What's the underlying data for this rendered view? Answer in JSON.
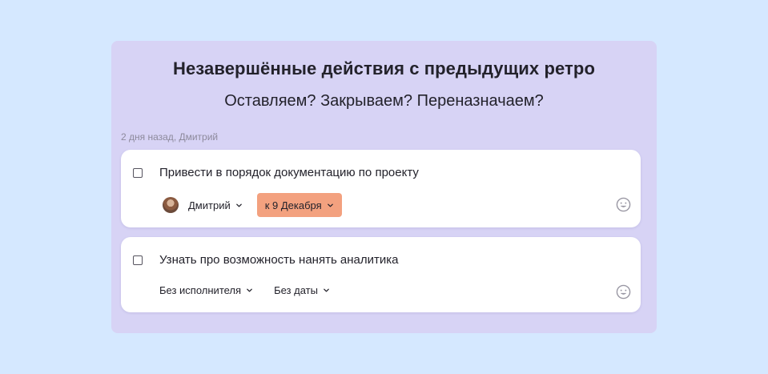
{
  "panel": {
    "title": "Незавершённые действия с предыдущих ретро",
    "subtitle": "Оставляем? Закрываем? Переназначаем?",
    "meta": "2 дня назад, Дмитрий"
  },
  "tasks": [
    {
      "text": "Привести в порядок документацию по проекту",
      "assignee": "Дмитрий",
      "due": "к 9 Декабря",
      "due_color": "#f3a17f",
      "checked": false
    },
    {
      "text": "Узнать про возможность нанять аналитика",
      "assignee": "Без исполнителя",
      "due": "Без даты",
      "checked": false
    }
  ],
  "icons": {
    "checkbox": "checkbox-icon",
    "chevron": "chevron-down-icon",
    "emoji": "smiley-icon",
    "avatar": "avatar"
  },
  "colors": {
    "page_background": "#d5e8ff",
    "panel_background": "#d7d3f5",
    "card_background": "#ffffff"
  }
}
